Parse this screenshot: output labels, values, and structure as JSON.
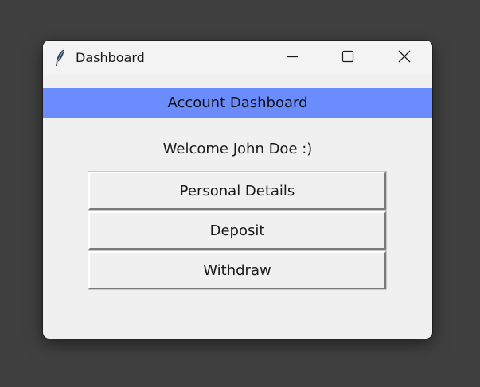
{
  "window": {
    "title": "Dashboard",
    "app_icon": "feather-icon",
    "controls": {
      "minimize_icon": "minimize-icon",
      "maximize_icon": "maximize-icon",
      "close_icon": "close-icon"
    }
  },
  "header": {
    "title": "Account Dashboard",
    "background_color": "#6a8cff"
  },
  "welcome": {
    "text": "Welcome John Doe :)"
  },
  "buttons": [
    {
      "label": "Personal Details"
    },
    {
      "label": "Deposit"
    },
    {
      "label": "Withdraw"
    }
  ]
}
